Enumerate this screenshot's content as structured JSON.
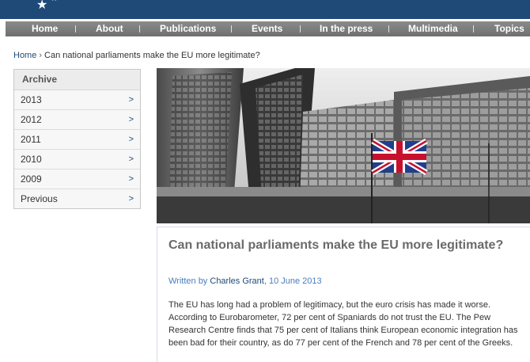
{
  "nav": {
    "items": [
      {
        "label": "Home"
      },
      {
        "label": "About"
      },
      {
        "label": "Publications"
      },
      {
        "label": "Events"
      },
      {
        "label": "In the press"
      },
      {
        "label": "Multimedia"
      },
      {
        "label": "Topics"
      }
    ]
  },
  "breadcrumb": {
    "home": "Home",
    "separator": "›",
    "current": "Can national parliaments make the EU more legitimate?"
  },
  "archive": {
    "title": "Archive",
    "chevron": ">",
    "items": [
      {
        "label": "2013"
      },
      {
        "label": "2012"
      },
      {
        "label": "2011"
      },
      {
        "label": "2010"
      },
      {
        "label": "2009"
      },
      {
        "label": "Previous"
      }
    ]
  },
  "article": {
    "title": "Can national parliaments make the EU more legitimate?",
    "written_by": "Written by",
    "author": "Charles Grant",
    "date": "10 June 2013",
    "body": "The EU has long had a problem of legitimacy, but the euro crisis has made it worse. According to Eurobarometer, 72 per cent of Spaniards do not trust the EU. The Pew Research Centre finds that 75 per cent of Italians think European economic integration has been bad for their country, as do 77 per cent of the French and 78 per cent of the Greeks."
  },
  "colors": {
    "brand_navy": "#1f4a78",
    "nav_grey": "#7a7a7a",
    "link_blue": "#4a7dbf"
  }
}
